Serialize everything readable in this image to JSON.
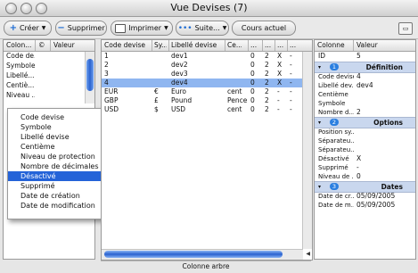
{
  "window": {
    "title": "Vue Devises  (7)"
  },
  "toolbar": {
    "create_label": "Créer",
    "delete_label": "Supprimer",
    "print_label": "Imprimer",
    "more_label": "Suite...",
    "current_label": "Cours actuel"
  },
  "left_panel": {
    "headers": [
      "Colon...",
      "©",
      "Valeur"
    ],
    "rows": [
      "Code de...",
      "Symbole",
      "Libellé...",
      "Centiè...",
      "Niveau ..."
    ]
  },
  "context_menu": {
    "items": [
      "Code devise",
      "Symbole",
      "Libellé devise",
      "Centième",
      "Niveau de protection",
      "Nombre de décimales",
      "Désactivé",
      "Supprimé",
      "Date de création",
      "Date de modification"
    ],
    "selected_index": 6
  },
  "main_table": {
    "headers": [
      "Code devise",
      "Sy...",
      "Libellé devise",
      "Ce...",
      "...",
      "...",
      "...",
      "..."
    ],
    "rows": [
      [
        "1",
        "",
        "dev1",
        "",
        "0",
        "2",
        "X",
        "-"
      ],
      [
        "2",
        "",
        "dev2",
        "",
        "0",
        "2",
        "X",
        "-"
      ],
      [
        "3",
        "",
        "dev3",
        "",
        "0",
        "2",
        "X",
        "-"
      ],
      [
        "4",
        "",
        "dev4",
        "",
        "0",
        "2",
        "X",
        "-"
      ],
      [
        "EUR",
        "€",
        "Euro",
        "cent",
        "0",
        "2",
        "-",
        "-"
      ],
      [
        "GBP",
        "£",
        "Pound",
        "Pence",
        "0",
        "2",
        "-",
        "-"
      ],
      [
        "USD",
        "$",
        "USD",
        "cent",
        "0",
        "2",
        "-",
        "-"
      ]
    ],
    "selected_row": 3
  },
  "detail_panel": {
    "headers": [
      "Colonne",
      "Valeur"
    ],
    "id_label": "ID",
    "id_value": "5",
    "groups": [
      {
        "num": "1",
        "label": "Définition"
      },
      {
        "num": "2",
        "label": "Options"
      },
      {
        "num": "3",
        "label": "Dates"
      }
    ],
    "definition_rows": [
      [
        "Code devise",
        "4"
      ],
      [
        "Libellé dev...",
        "dev4"
      ],
      [
        "Centième",
        ""
      ],
      [
        "Symbole",
        ""
      ],
      [
        "Nombre d...",
        "2"
      ]
    ],
    "options_rows": [
      [
        "Position sy...",
        ""
      ],
      [
        "Séparateu...",
        ""
      ],
      [
        "Séparateu...",
        ""
      ],
      [
        "Désactivé",
        "X"
      ],
      [
        "Supprimé",
        "-"
      ],
      [
        "Niveau de ...",
        "0"
      ]
    ],
    "dates_rows": [
      [
        "Date de cr...",
        "05/09/2005"
      ],
      [
        "Date de m...",
        "05/09/2005"
      ]
    ]
  },
  "status": {
    "label": "Colonne arbre"
  },
  "colors": {
    "selection": "#2463d8",
    "row_highlight": "#8fb6f0",
    "group_band": "#c9d7ee"
  }
}
